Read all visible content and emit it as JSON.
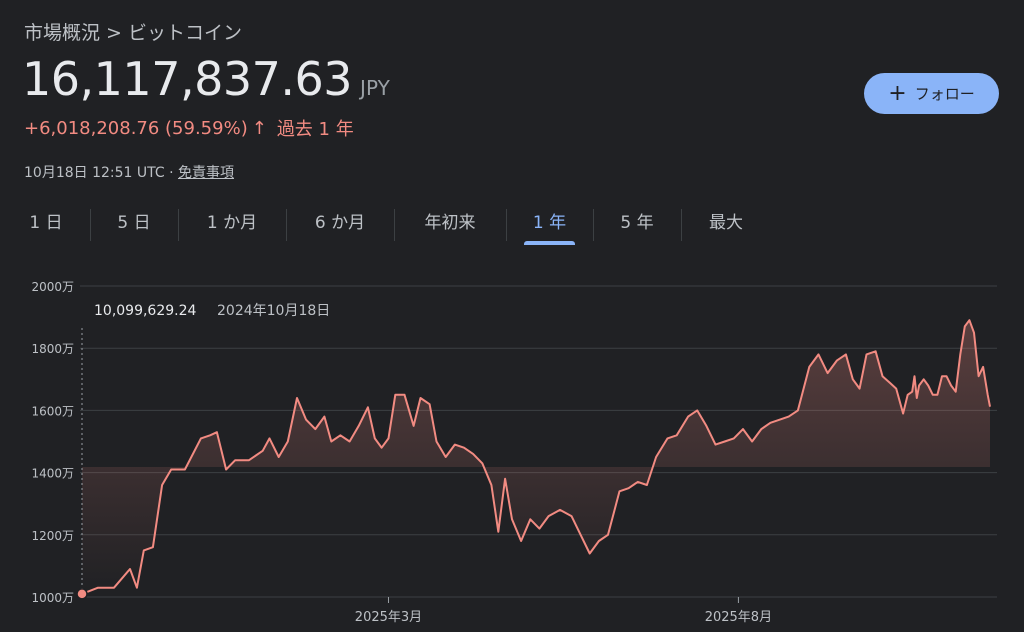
{
  "header": {
    "breadcrumb": "市場概況 > ビットコイン",
    "price": "16,117,837.63",
    "currency": "JPY",
    "change": "+6,018,208.76 (59.59%)",
    "change_arrow": "↑",
    "change_period": "過去 1 年",
    "timestamp": "10月18日 12:51 UTC",
    "separator": "·",
    "disclaimer": "免責事項"
  },
  "follow_button": {
    "icon": "plus-icon",
    "label": "フォロー"
  },
  "tabs": [
    {
      "label": "1 日",
      "active": false
    },
    {
      "label": "5 日",
      "active": false
    },
    {
      "label": "1 か月",
      "active": false
    },
    {
      "label": "6 か月",
      "active": false
    },
    {
      "label": "年初来",
      "active": false
    },
    {
      "label": "1 年",
      "active": true
    },
    {
      "label": "5 年",
      "active": false
    },
    {
      "label": "最大",
      "active": false
    }
  ],
  "colors": {
    "background": "#202124",
    "line": "#f28b82",
    "accent": "#8ab4f8",
    "grid": "#3c4043"
  },
  "chart_data": {
    "type": "area",
    "y_unit": "JPY (万)",
    "ylim": [
      10000000,
      20000000
    ],
    "y_ticks": [
      {
        "value": 20000000,
        "label": "2000万"
      },
      {
        "value": 18000000,
        "label": "1800万"
      },
      {
        "value": 16000000,
        "label": "1600万"
      },
      {
        "value": 14000000,
        "label": "1400万"
      },
      {
        "value": 12000000,
        "label": "1200万"
      },
      {
        "value": 10000000,
        "label": "1000万"
      }
    ],
    "x_range": [
      "2024-10-18",
      "2025-10-18"
    ],
    "x_ticks": [
      {
        "date": "2025-03-01",
        "label": "2025年3月"
      },
      {
        "date": "2025-08-01",
        "label": "2025年8月"
      }
    ],
    "grid": true,
    "tooltip": {
      "value_label": "10,099,629.24",
      "date_label": "2024年10月18日",
      "date": "2024-10-18"
    },
    "series": [
      {
        "points": [
          [
            "2024-10-18",
            10099629
          ],
          [
            "2024-10-25",
            10300000
          ],
          [
            "2024-11-01",
            10300000
          ],
          [
            "2024-11-08",
            10900000
          ],
          [
            "2024-11-11",
            10300000
          ],
          [
            "2024-11-14",
            11500000
          ],
          [
            "2024-11-18",
            11600000
          ],
          [
            "2024-11-22",
            13600000
          ],
          [
            "2024-11-26",
            14100000
          ],
          [
            "2024-12-02",
            14100000
          ],
          [
            "2024-12-09",
            15100000
          ],
          [
            "2024-12-13",
            15200000
          ],
          [
            "2024-12-16",
            15300000
          ],
          [
            "2024-12-20",
            14100000
          ],
          [
            "2024-12-24",
            14400000
          ],
          [
            "2024-12-30",
            14400000
          ],
          [
            "2025-01-05",
            14700000
          ],
          [
            "2025-01-08",
            15100000
          ],
          [
            "2025-01-12",
            14500000
          ],
          [
            "2025-01-16",
            15000000
          ],
          [
            "2025-01-20",
            16400000
          ],
          [
            "2025-01-24",
            15700000
          ],
          [
            "2025-01-28",
            15400000
          ],
          [
            "2025-02-01",
            15800000
          ],
          [
            "2025-02-04",
            15000000
          ],
          [
            "2025-02-08",
            15200000
          ],
          [
            "2025-02-12",
            15000000
          ],
          [
            "2025-02-16",
            15500000
          ],
          [
            "2025-02-20",
            16100000
          ],
          [
            "2025-02-23",
            15100000
          ],
          [
            "2025-02-26",
            14800000
          ],
          [
            "2025-03-01",
            15100000
          ],
          [
            "2025-03-04",
            16500000
          ],
          [
            "2025-03-08",
            16500000
          ],
          [
            "2025-03-12",
            15500000
          ],
          [
            "2025-03-15",
            16400000
          ],
          [
            "2025-03-19",
            16200000
          ],
          [
            "2025-03-22",
            15000000
          ],
          [
            "2025-03-26",
            14500000
          ],
          [
            "2025-03-30",
            14900000
          ],
          [
            "2025-04-03",
            14800000
          ],
          [
            "2025-04-07",
            14600000
          ],
          [
            "2025-04-11",
            14300000
          ],
          [
            "2025-04-15",
            13600000
          ],
          [
            "2025-04-18",
            12100000
          ],
          [
            "2025-04-21",
            13800000
          ],
          [
            "2025-04-24",
            12500000
          ],
          [
            "2025-04-28",
            11800000
          ],
          [
            "2025-05-02",
            12500000
          ],
          [
            "2025-05-06",
            12200000
          ],
          [
            "2025-05-10",
            12600000
          ],
          [
            "2025-05-15",
            12800000
          ],
          [
            "2025-05-20",
            12600000
          ],
          [
            "2025-05-24",
            12000000
          ],
          [
            "2025-05-28",
            11400000
          ],
          [
            "2025-06-01",
            11800000
          ],
          [
            "2025-06-05",
            12000000
          ],
          [
            "2025-06-10",
            13400000
          ],
          [
            "2025-06-14",
            13500000
          ],
          [
            "2025-06-18",
            13700000
          ],
          [
            "2025-06-22",
            13600000
          ],
          [
            "2025-06-26",
            14500000
          ],
          [
            "2025-07-01",
            15100000
          ],
          [
            "2025-07-05",
            15200000
          ],
          [
            "2025-07-10",
            15800000
          ],
          [
            "2025-07-14",
            16000000
          ],
          [
            "2025-07-18",
            15500000
          ],
          [
            "2025-07-22",
            14900000
          ],
          [
            "2025-07-26",
            15000000
          ],
          [
            "2025-07-30",
            15100000
          ],
          [
            "2025-08-03",
            15400000
          ],
          [
            "2025-08-07",
            15000000
          ],
          [
            "2025-08-11",
            15400000
          ],
          [
            "2025-08-15",
            15600000
          ],
          [
            "2025-08-19",
            15700000
          ],
          [
            "2025-08-23",
            15800000
          ],
          [
            "2025-08-27",
            16000000
          ],
          [
            "2025-09-01",
            17400000
          ],
          [
            "2025-09-05",
            17800000
          ],
          [
            "2025-09-09",
            17200000
          ],
          [
            "2025-09-13",
            17600000
          ],
          [
            "2025-09-17",
            17800000
          ],
          [
            "2025-09-20",
            17000000
          ],
          [
            "2025-09-23",
            16700000
          ],
          [
            "2025-09-26",
            17800000
          ],
          [
            "2025-09-30",
            17900000
          ],
          [
            "2025-10-03",
            17100000
          ],
          [
            "2025-10-06",
            16900000
          ],
          [
            "2025-10-09",
            16700000
          ],
          [
            "2025-10-12",
            15900000
          ],
          [
            "2025-10-14",
            16500000
          ],
          [
            "2025-10-16",
            16600000
          ],
          [
            "2025-10-17",
            17100000
          ],
          [
            "2025-10-18",
            16400000
          ],
          [
            "2025-10-19",
            16800000
          ],
          [
            "2025-10-21",
            17000000
          ],
          [
            "2025-10-23",
            16800000
          ],
          [
            "2025-10-25",
            16500000
          ],
          [
            "2025-10-27",
            16500000
          ],
          [
            "2025-10-29",
            17100000
          ],
          [
            "2025-10-31",
            17100000
          ],
          [
            "2025-11-02",
            16800000
          ],
          [
            "2025-11-04",
            16600000
          ],
          [
            "2025-11-06",
            17800000
          ],
          [
            "2025-11-08",
            18700000
          ],
          [
            "2025-11-10",
            18900000
          ],
          [
            "2025-11-12",
            18500000
          ],
          [
            "2025-11-14",
            17100000
          ],
          [
            "2025-11-16",
            17400000
          ],
          [
            "2025-11-18",
            16500000
          ],
          [
            "2025-11-19",
            16117838
          ]
        ]
      }
    ]
  }
}
